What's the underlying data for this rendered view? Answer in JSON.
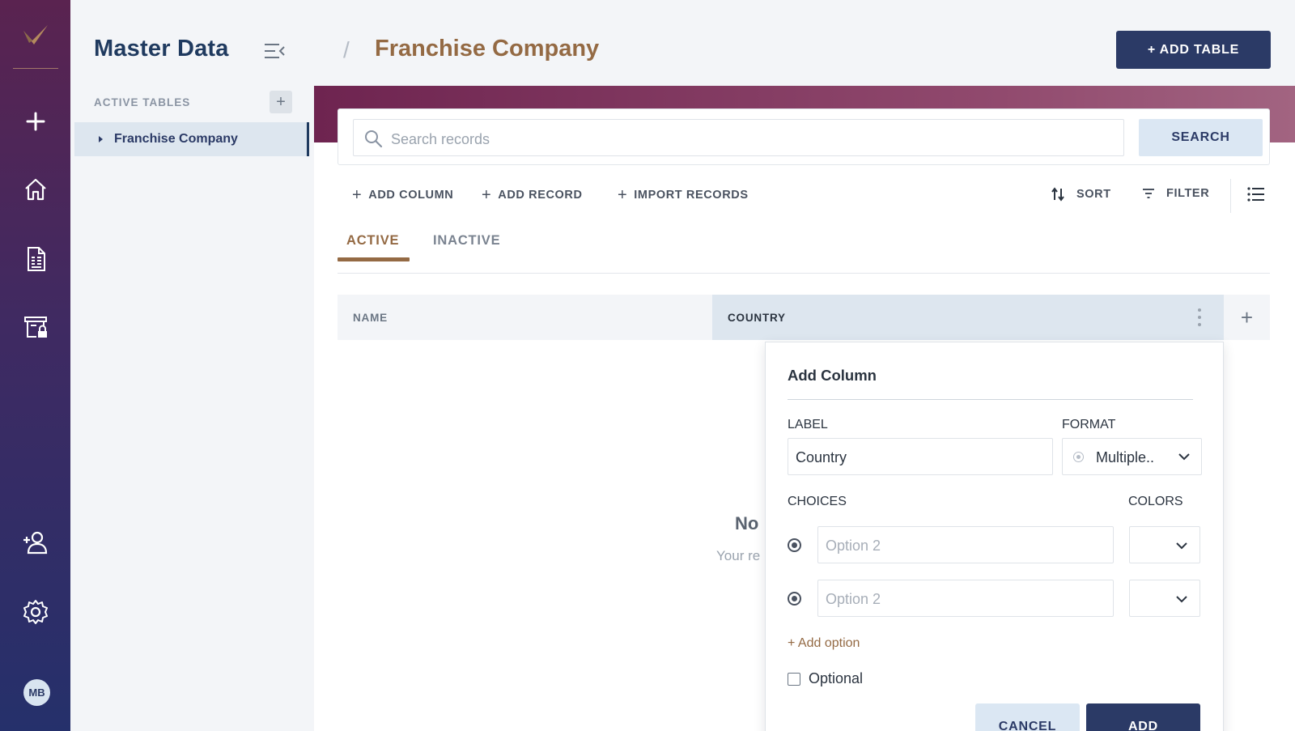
{
  "rail": {
    "icons": [
      "logo-icon",
      "plus-icon",
      "home-icon",
      "document-icon",
      "archive-lock-icon",
      "add-user-icon",
      "gear-icon"
    ],
    "avatar": "MB"
  },
  "sidebar": {
    "title": "Master Data",
    "section_label": "ACTIVE TABLES",
    "add_label": "+",
    "items": [
      {
        "label": "Franchise Company"
      }
    ]
  },
  "header": {
    "separator": "/",
    "title": "Franchise Company",
    "add_table_label": "+ ADD TABLE"
  },
  "search": {
    "placeholder": "Search records",
    "button_label": "SEARCH"
  },
  "toolbar": {
    "add_column": "ADD COLUMN",
    "add_record": "ADD RECORD",
    "import_records": "IMPORT RECORDS",
    "sort": "SORT",
    "filter": "FILTER"
  },
  "tabs": [
    {
      "label": "ACTIVE",
      "active": true
    },
    {
      "label": "INACTIVE",
      "active": false
    }
  ],
  "table": {
    "columns": [
      "NAME",
      "COUNTRY"
    ],
    "add_column_symbol": "+"
  },
  "empty_state": {
    "title": "No",
    "subtitle": "Your re"
  },
  "popup": {
    "title": "Add Column",
    "label_field": {
      "label": "LABEL",
      "value": "Country"
    },
    "format_field": {
      "label": "FORMAT",
      "value": "Multiple.."
    },
    "choices_label": "CHOICES",
    "colors_label": "COLORS",
    "choices": [
      {
        "placeholder": "Option 2"
      },
      {
        "placeholder": "Option 2"
      }
    ],
    "add_option": "+ Add option",
    "optional_label": "Optional",
    "cancel_label": "CANCEL",
    "add_label": "ADD"
  },
  "colors": {
    "primary": "#2b3a66",
    "accent": "#946a44",
    "banner_start": "#6e2450",
    "banner_end": "#a26481"
  }
}
